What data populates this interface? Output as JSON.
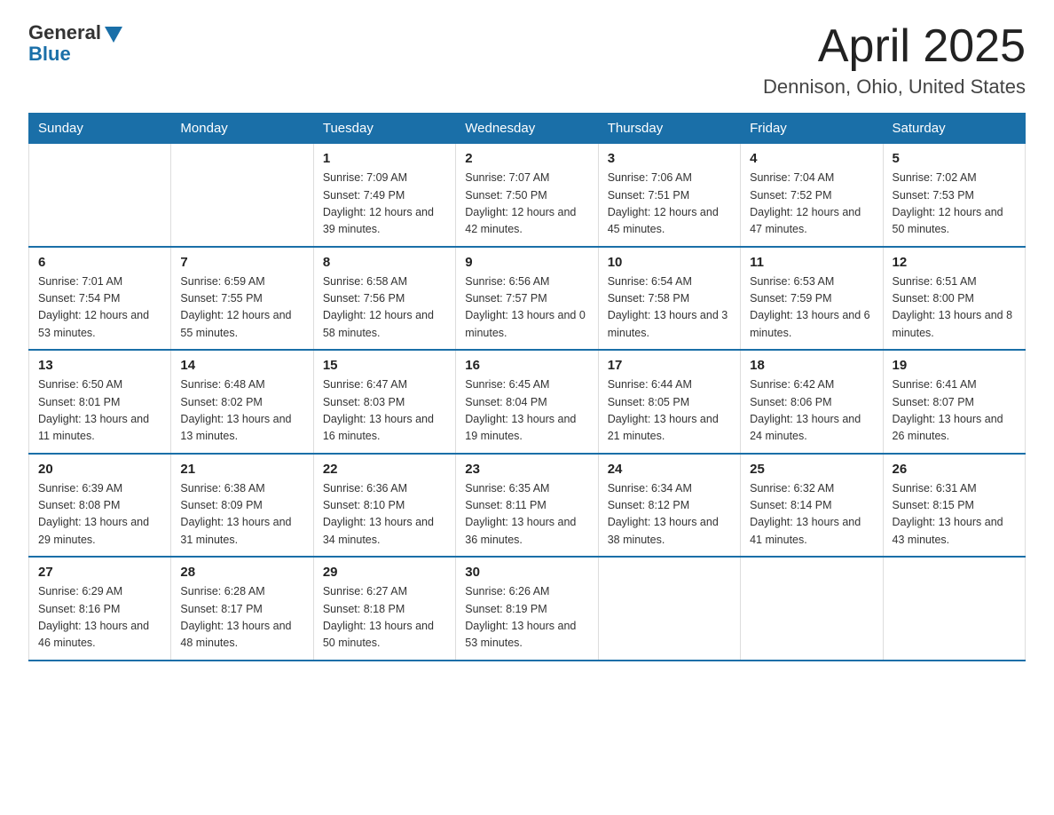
{
  "header": {
    "logo_general": "General",
    "logo_blue": "Blue",
    "month_title": "April 2025",
    "location": "Dennison, Ohio, United States"
  },
  "weekdays": [
    "Sunday",
    "Monday",
    "Tuesday",
    "Wednesday",
    "Thursday",
    "Friday",
    "Saturday"
  ],
  "weeks": [
    [
      {
        "day": "",
        "info": ""
      },
      {
        "day": "",
        "info": ""
      },
      {
        "day": "1",
        "info": "Sunrise: 7:09 AM\nSunset: 7:49 PM\nDaylight: 12 hours\nand 39 minutes."
      },
      {
        "day": "2",
        "info": "Sunrise: 7:07 AM\nSunset: 7:50 PM\nDaylight: 12 hours\nand 42 minutes."
      },
      {
        "day": "3",
        "info": "Sunrise: 7:06 AM\nSunset: 7:51 PM\nDaylight: 12 hours\nand 45 minutes."
      },
      {
        "day": "4",
        "info": "Sunrise: 7:04 AM\nSunset: 7:52 PM\nDaylight: 12 hours\nand 47 minutes."
      },
      {
        "day": "5",
        "info": "Sunrise: 7:02 AM\nSunset: 7:53 PM\nDaylight: 12 hours\nand 50 minutes."
      }
    ],
    [
      {
        "day": "6",
        "info": "Sunrise: 7:01 AM\nSunset: 7:54 PM\nDaylight: 12 hours\nand 53 minutes."
      },
      {
        "day": "7",
        "info": "Sunrise: 6:59 AM\nSunset: 7:55 PM\nDaylight: 12 hours\nand 55 minutes."
      },
      {
        "day": "8",
        "info": "Sunrise: 6:58 AM\nSunset: 7:56 PM\nDaylight: 12 hours\nand 58 minutes."
      },
      {
        "day": "9",
        "info": "Sunrise: 6:56 AM\nSunset: 7:57 PM\nDaylight: 13 hours\nand 0 minutes."
      },
      {
        "day": "10",
        "info": "Sunrise: 6:54 AM\nSunset: 7:58 PM\nDaylight: 13 hours\nand 3 minutes."
      },
      {
        "day": "11",
        "info": "Sunrise: 6:53 AM\nSunset: 7:59 PM\nDaylight: 13 hours\nand 6 minutes."
      },
      {
        "day": "12",
        "info": "Sunrise: 6:51 AM\nSunset: 8:00 PM\nDaylight: 13 hours\nand 8 minutes."
      }
    ],
    [
      {
        "day": "13",
        "info": "Sunrise: 6:50 AM\nSunset: 8:01 PM\nDaylight: 13 hours\nand 11 minutes."
      },
      {
        "day": "14",
        "info": "Sunrise: 6:48 AM\nSunset: 8:02 PM\nDaylight: 13 hours\nand 13 minutes."
      },
      {
        "day": "15",
        "info": "Sunrise: 6:47 AM\nSunset: 8:03 PM\nDaylight: 13 hours\nand 16 minutes."
      },
      {
        "day": "16",
        "info": "Sunrise: 6:45 AM\nSunset: 8:04 PM\nDaylight: 13 hours\nand 19 minutes."
      },
      {
        "day": "17",
        "info": "Sunrise: 6:44 AM\nSunset: 8:05 PM\nDaylight: 13 hours\nand 21 minutes."
      },
      {
        "day": "18",
        "info": "Sunrise: 6:42 AM\nSunset: 8:06 PM\nDaylight: 13 hours\nand 24 minutes."
      },
      {
        "day": "19",
        "info": "Sunrise: 6:41 AM\nSunset: 8:07 PM\nDaylight: 13 hours\nand 26 minutes."
      }
    ],
    [
      {
        "day": "20",
        "info": "Sunrise: 6:39 AM\nSunset: 8:08 PM\nDaylight: 13 hours\nand 29 minutes."
      },
      {
        "day": "21",
        "info": "Sunrise: 6:38 AM\nSunset: 8:09 PM\nDaylight: 13 hours\nand 31 minutes."
      },
      {
        "day": "22",
        "info": "Sunrise: 6:36 AM\nSunset: 8:10 PM\nDaylight: 13 hours\nand 34 minutes."
      },
      {
        "day": "23",
        "info": "Sunrise: 6:35 AM\nSunset: 8:11 PM\nDaylight: 13 hours\nand 36 minutes."
      },
      {
        "day": "24",
        "info": "Sunrise: 6:34 AM\nSunset: 8:12 PM\nDaylight: 13 hours\nand 38 minutes."
      },
      {
        "day": "25",
        "info": "Sunrise: 6:32 AM\nSunset: 8:14 PM\nDaylight: 13 hours\nand 41 minutes."
      },
      {
        "day": "26",
        "info": "Sunrise: 6:31 AM\nSunset: 8:15 PM\nDaylight: 13 hours\nand 43 minutes."
      }
    ],
    [
      {
        "day": "27",
        "info": "Sunrise: 6:29 AM\nSunset: 8:16 PM\nDaylight: 13 hours\nand 46 minutes."
      },
      {
        "day": "28",
        "info": "Sunrise: 6:28 AM\nSunset: 8:17 PM\nDaylight: 13 hours\nand 48 minutes."
      },
      {
        "day": "29",
        "info": "Sunrise: 6:27 AM\nSunset: 8:18 PM\nDaylight: 13 hours\nand 50 minutes."
      },
      {
        "day": "30",
        "info": "Sunrise: 6:26 AM\nSunset: 8:19 PM\nDaylight: 13 hours\nand 53 minutes."
      },
      {
        "day": "",
        "info": ""
      },
      {
        "day": "",
        "info": ""
      },
      {
        "day": "",
        "info": ""
      }
    ]
  ]
}
